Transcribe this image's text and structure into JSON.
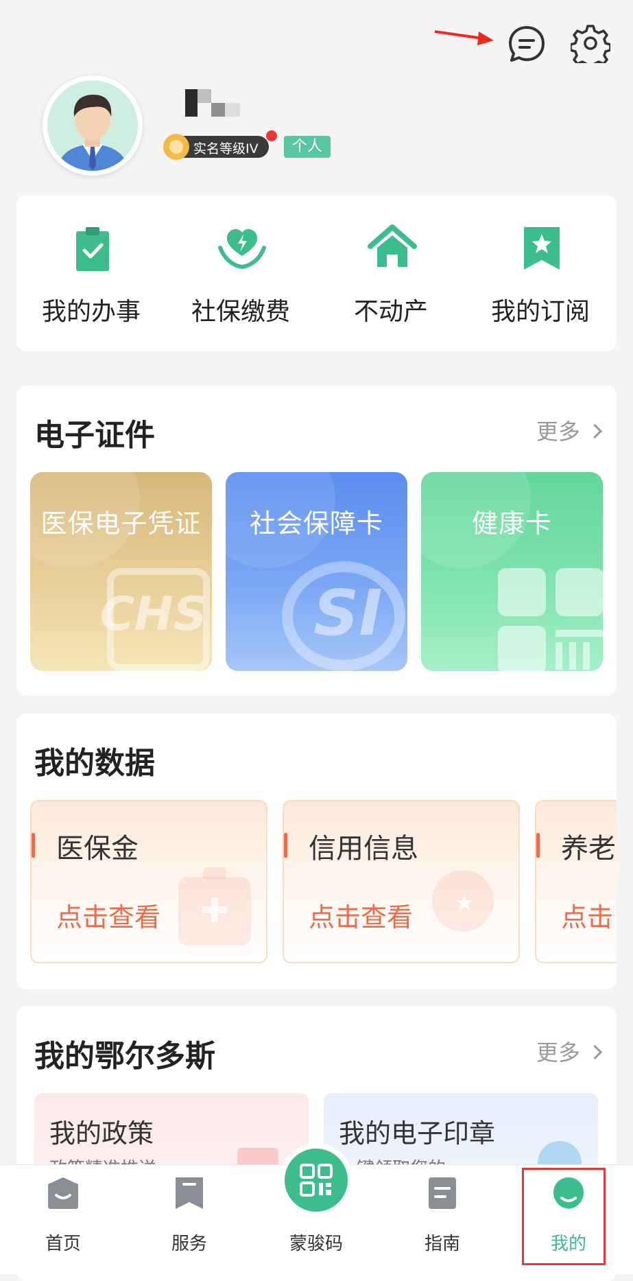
{
  "profile": {
    "verify_badge": "实名等级IV",
    "type_tag": "个人"
  },
  "quick_actions": [
    {
      "label": "我的办事",
      "icon": "clipboard-check-icon"
    },
    {
      "label": "社保缴费",
      "icon": "heart-hands-icon"
    },
    {
      "label": "不动产",
      "icon": "house-icon"
    },
    {
      "label": "我的订阅",
      "icon": "bookmark-star-icon"
    }
  ],
  "ecerts": {
    "title": "电子证件",
    "more": "更多",
    "cards": [
      {
        "label": "医保电子凭证",
        "watermark": "CHS"
      },
      {
        "label": "社会保障卡",
        "watermark": "SI"
      },
      {
        "label": "健康卡"
      }
    ]
  },
  "mydata": {
    "title": "我的数据",
    "cards": [
      {
        "label": "医保金",
        "link": "点击查看"
      },
      {
        "label": "信用信息",
        "link": "点击查看"
      },
      {
        "label": "养老",
        "link": "点击"
      }
    ]
  },
  "ordos": {
    "title": "我的鄂尔多斯",
    "more": "更多",
    "cards": [
      {
        "label": "我的政策",
        "sub": "政策精准推送 >"
      },
      {
        "label": "我的电子印章",
        "sub": "一键领取您的... >"
      }
    ]
  },
  "tabbar": [
    {
      "label": "首页",
      "icon": "home-icon"
    },
    {
      "label": "服务",
      "icon": "bookmark-icon"
    },
    {
      "label": "蒙骏码",
      "icon": "qr-code-icon"
    },
    {
      "label": "指南",
      "icon": "guide-icon"
    },
    {
      "label": "我的",
      "icon": "profile-icon",
      "active": true
    }
  ],
  "colors": {
    "accent": "#3dbc8e",
    "highlight_box": "#e53935",
    "data_link": "#ef6a4a"
  }
}
